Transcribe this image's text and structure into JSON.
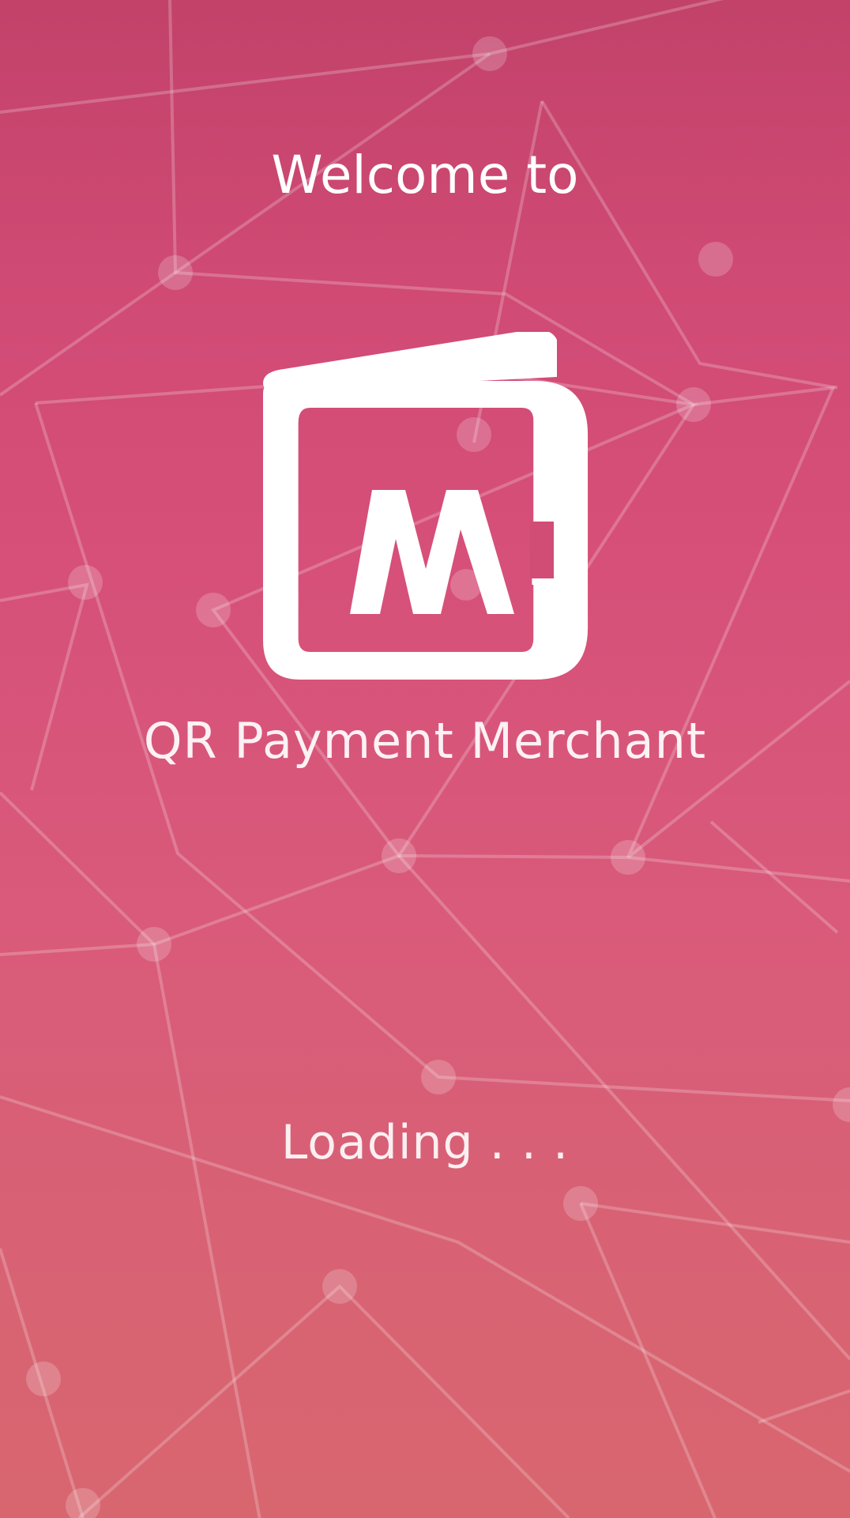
{
  "splash": {
    "welcome_text": "Welcome to",
    "logo_icon": "wallet-m-logo-icon",
    "logo_letter": "M",
    "app_name": "QR Payment Merchant",
    "loading_text": "Loading . . ."
  },
  "colors": {
    "gradient_top": "#c2426a",
    "gradient_mid": "#d64f79",
    "gradient_bottom": "#d8666f",
    "text": "#ffffff"
  }
}
